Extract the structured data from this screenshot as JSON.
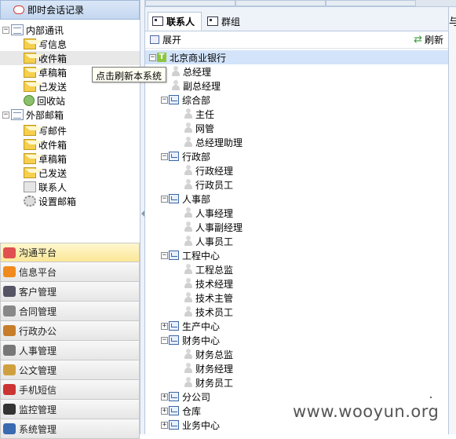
{
  "left_panel": {
    "header_title": "即时会话记录",
    "tree": [
      {
        "label": "内部通讯",
        "level": 0,
        "icon": "mailbook-icon",
        "expander": "−"
      },
      {
        "label": "写信息",
        "level": 1,
        "icon": "envelope-icon"
      },
      {
        "label": "收件箱",
        "level": 1,
        "icon": "envelope-icon"
      },
      {
        "label": "草稿箱",
        "level": 1,
        "icon": "envelope-icon"
      },
      {
        "label": "已发送",
        "level": 1,
        "icon": "envelope-icon"
      },
      {
        "label": "回收站",
        "level": 1,
        "icon": "recycle-icon"
      },
      {
        "label": "外部邮箱",
        "level": 0,
        "icon": "mailbook-icon",
        "expander": "−"
      },
      {
        "label": "写邮件",
        "level": 1,
        "icon": "envelope-icon"
      },
      {
        "label": "收件箱",
        "level": 1,
        "icon": "envelope-icon"
      },
      {
        "label": "草稿箱",
        "level": 1,
        "icon": "envelope-icon"
      },
      {
        "label": "已发送",
        "level": 1,
        "icon": "envelope-icon"
      },
      {
        "label": "联系人",
        "level": 1,
        "icon": "contact-icon"
      },
      {
        "label": "设置邮箱",
        "level": 1,
        "icon": "gear-icon"
      }
    ],
    "tooltip": "点击刷新本系统",
    "nav": [
      {
        "label": "沟通平台",
        "icon": "chat-icon",
        "color": "#e05050"
      },
      {
        "label": "信息平台",
        "icon": "rss-icon",
        "color": "#f08a1c"
      },
      {
        "label": "客户管理",
        "icon": "customer-icon",
        "color": "#556"
      },
      {
        "label": "合同管理",
        "icon": "contract-icon",
        "color": "#888"
      },
      {
        "label": "行政办公",
        "icon": "house-icon",
        "color": "#c77d2a"
      },
      {
        "label": "人事管理",
        "icon": "person-icon",
        "color": "#777"
      },
      {
        "label": "公文管理",
        "icon": "document-icon",
        "color": "#d0a040"
      },
      {
        "label": "手机短信",
        "icon": "phone-icon",
        "color": "#c33"
      },
      {
        "label": "监控管理",
        "icon": "binoculars-icon",
        "color": "#333"
      },
      {
        "label": "系统管理",
        "icon": "system-icon",
        "color": "#3a6ab0"
      }
    ]
  },
  "right_panel": {
    "tabs": [
      {
        "label": "联系人",
        "active": true
      },
      {
        "label": "群组",
        "active": false
      }
    ],
    "toolbar": {
      "expand_label": "展开",
      "refresh_label": "刷新"
    },
    "tree": [
      {
        "label": "北京商业银行",
        "level": 0,
        "type": "root",
        "expander": "−"
      },
      {
        "label": "总经理",
        "level": 1,
        "type": "person"
      },
      {
        "label": "副总经理",
        "level": 1,
        "type": "person"
      },
      {
        "label": "综合部",
        "level": 1,
        "type": "dept",
        "expander": "−"
      },
      {
        "label": "主任",
        "level": 2,
        "type": "person"
      },
      {
        "label": "网管",
        "level": 2,
        "type": "person"
      },
      {
        "label": "总经理助理",
        "level": 2,
        "type": "person"
      },
      {
        "label": "行政部",
        "level": 1,
        "type": "dept",
        "expander": "−"
      },
      {
        "label": "行政经理",
        "level": 2,
        "type": "person"
      },
      {
        "label": "行政员工",
        "level": 2,
        "type": "person"
      },
      {
        "label": "人事部",
        "level": 1,
        "type": "dept",
        "expander": "−"
      },
      {
        "label": "人事经理",
        "level": 2,
        "type": "person"
      },
      {
        "label": "人事副经理",
        "level": 2,
        "type": "person"
      },
      {
        "label": "人事员工",
        "level": 2,
        "type": "person"
      },
      {
        "label": "工程中心",
        "level": 1,
        "type": "dept",
        "expander": "−"
      },
      {
        "label": "工程总监",
        "level": 2,
        "type": "person"
      },
      {
        "label": "技术经理",
        "level": 2,
        "type": "person"
      },
      {
        "label": "技术主管",
        "level": 2,
        "type": "person"
      },
      {
        "label": "技术员工",
        "level": 2,
        "type": "person"
      },
      {
        "label": "生产中心",
        "level": 1,
        "type": "dept",
        "expander": "+"
      },
      {
        "label": "财务中心",
        "level": 1,
        "type": "dept",
        "expander": "−"
      },
      {
        "label": "财务总监",
        "level": 2,
        "type": "person"
      },
      {
        "label": "财务经理",
        "level": 2,
        "type": "person"
      },
      {
        "label": "财务员工",
        "level": 2,
        "type": "person"
      },
      {
        "label": "分公司",
        "level": 1,
        "type": "dept",
        "expander": "+"
      },
      {
        "label": "仓库",
        "level": 1,
        "type": "dept",
        "expander": "+"
      },
      {
        "label": "业务中心",
        "level": 1,
        "type": "dept",
        "expander": "+"
      }
    ]
  },
  "far_right_text": "与",
  "watermark": "www.wooyun.org"
}
